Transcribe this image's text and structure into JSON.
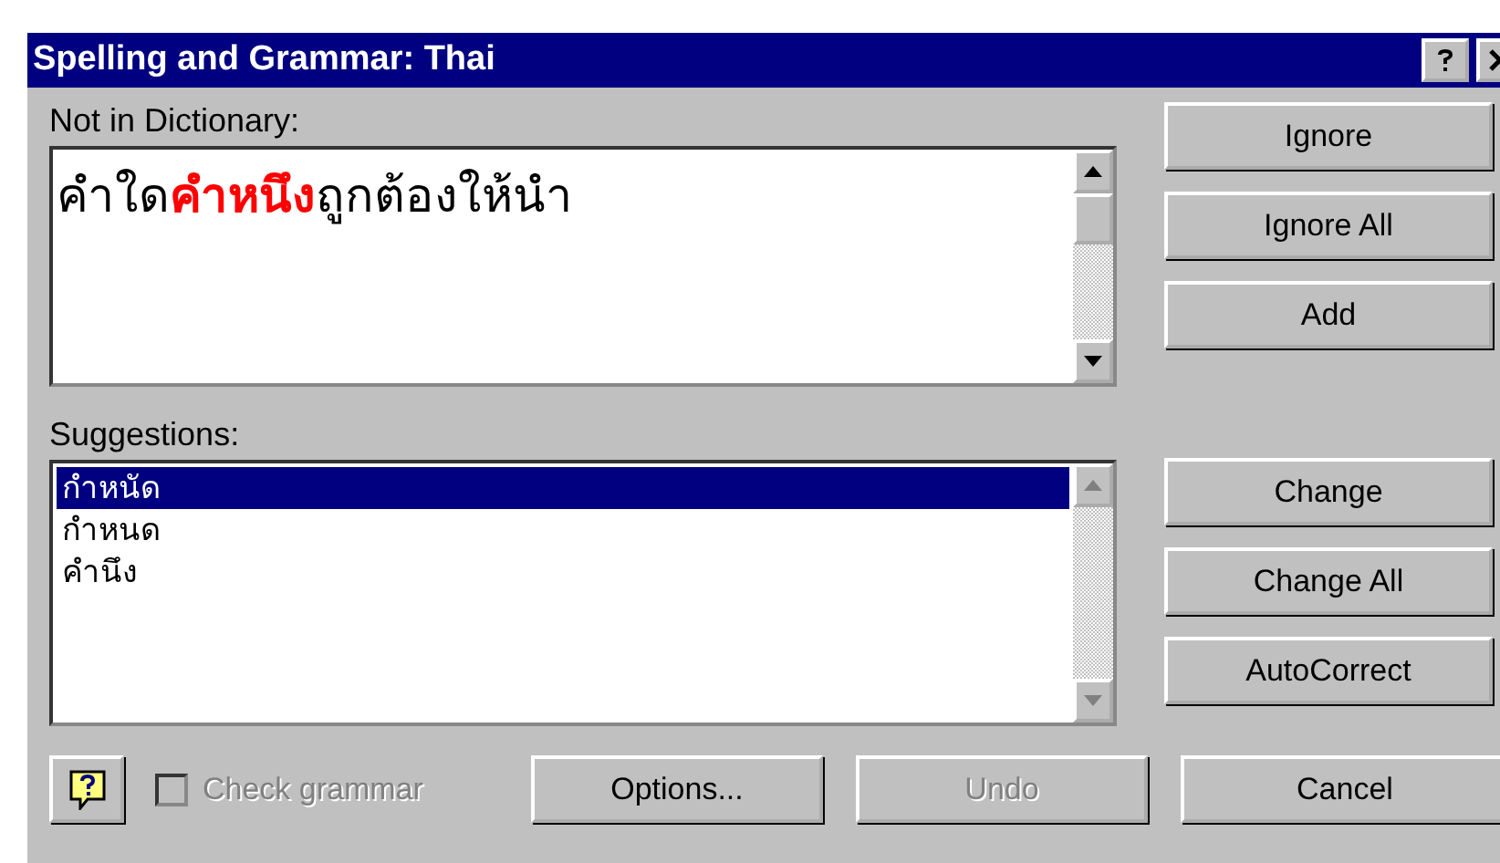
{
  "window": {
    "title": "Spelling and Grammar: Thai"
  },
  "not_in_dictionary": {
    "label": "Not in Dictionary:",
    "text": "คำใด**คำหนึง**ถูกต้องให้นำ"
  },
  "suggestions": {
    "label": "Suggestions:",
    "items": [
      {
        "text": "กำหนัด",
        "selected": true
      },
      {
        "text": "กำหนด",
        "selected": false
      },
      {
        "text": "คำนึง",
        "selected": false
      }
    ]
  },
  "top_buttons": [
    {
      "label": "Ignore",
      "disabled": false
    },
    {
      "label": "Ignore All",
      "disabled": false
    },
    {
      "label": "Add",
      "disabled": false
    }
  ],
  "change_buttons": [
    {
      "label": "Change",
      "disabled": false
    },
    {
      "label": "Change All",
      "disabled": false
    },
    {
      "label": "AutoCorrect",
      "disabled": false
    }
  ],
  "check_grammar": {
    "label": "Check grammar",
    "checked": false,
    "disabled": true
  },
  "bottom_buttons": [
    {
      "label": "Options...",
      "disabled": false
    },
    {
      "label": "Undo",
      "disabled": true
    },
    {
      "label": "Cancel",
      "disabled": false
    }
  ]
}
